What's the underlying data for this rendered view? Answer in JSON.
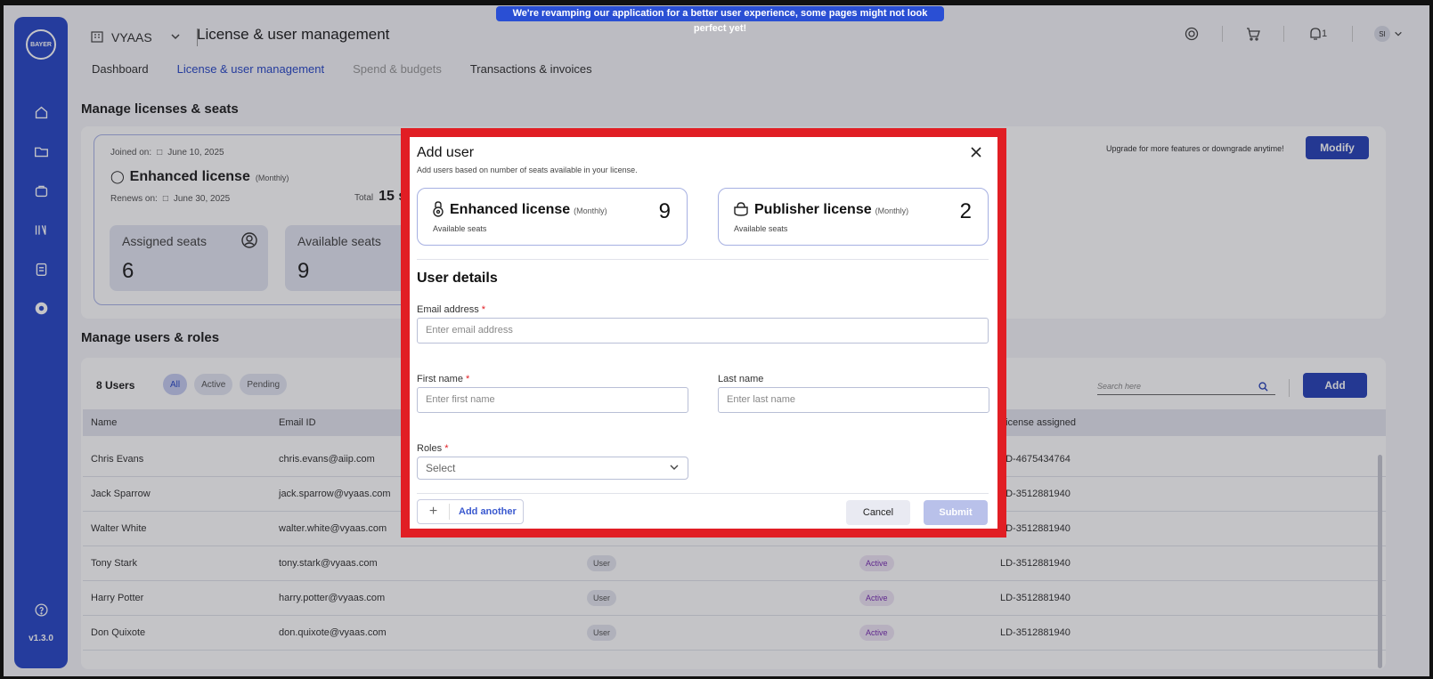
{
  "banner": "We're revamping our application for a better user experience, some pages might not look perfect yet!",
  "sidebar": {
    "logo": "BAYER",
    "icons": [
      "home-icon",
      "folder-icon",
      "bag-icon",
      "library-icon",
      "clipboard-icon",
      "settings-icon",
      "help-icon"
    ],
    "version": "v1.3.0"
  },
  "header": {
    "org": "VYAAS",
    "title": "License & user management",
    "notifications_count": "1",
    "avatar": "SI"
  },
  "tabs": [
    {
      "label": "Dashboard"
    },
    {
      "label": "License & user management"
    },
    {
      "label": "Spend & budgets"
    },
    {
      "label": "Transactions & invoices"
    }
  ],
  "licenses_section": {
    "title": "Manage licenses & seats",
    "joined_label": "Joined on:",
    "joined_date": "June 10, 2025",
    "license_name": "Enhanced license",
    "license_period": "(Monthly)",
    "renews_label": "Renews on:",
    "renews_date": "June 30, 2025",
    "total_label": "Total",
    "total_value": "15 s",
    "assigned_label": "Assigned seats",
    "assigned_value": "6",
    "available_label": "Available seats",
    "available_value": "9",
    "upgrade_text": "Upgrade for more features or downgrade anytime!",
    "modify_label": "Modify"
  },
  "users_section": {
    "title": "Manage users & roles",
    "count": "8 Users",
    "filters": [
      "All",
      "Active",
      "Pending"
    ],
    "search_placeholder": "Search here",
    "add_label": "Add",
    "columns": [
      "Name",
      "Email ID",
      "License assigned"
    ],
    "rows": [
      {
        "name": "Chris Evans",
        "email": "chris.evans@aiip.com",
        "role": "",
        "status": "",
        "license": "LD-4675434764"
      },
      {
        "name": "Jack Sparrow",
        "email": "jack.sparrow@vyaas.com",
        "role": "",
        "status": "",
        "license": "LD-3512881940"
      },
      {
        "name": "Walter White",
        "email": "walter.white@vyaas.com",
        "role": "",
        "status": "",
        "license": "LD-3512881940"
      },
      {
        "name": "Tony Stark",
        "email": "tony.stark@vyaas.com",
        "role": "User",
        "status": "Active",
        "license": "LD-3512881940"
      },
      {
        "name": "Harry Potter",
        "email": "harry.potter@vyaas.com",
        "role": "User",
        "status": "Active",
        "license": "LD-3512881940"
      },
      {
        "name": "Don Quixote",
        "email": "don.quixote@vyaas.com",
        "role": "User",
        "status": "Active",
        "license": "LD-3512881940"
      }
    ]
  },
  "modal": {
    "title": "Add user",
    "subtitle": "Add users based on number of seats available in your license.",
    "licenses": [
      {
        "name": "Enhanced license",
        "period": "(Monthly)",
        "seats_label": "Available seats",
        "seats": "9"
      },
      {
        "name": "Publisher license",
        "period": "(Monthly)",
        "seats_label": "Available seats",
        "seats": "2"
      }
    ],
    "details_title": "User details",
    "email_label": "Email address",
    "email_placeholder": "Enter email address",
    "first_name_label": "First name",
    "first_name_placeholder": "Enter first name",
    "last_name_label": "Last name",
    "last_name_placeholder": "Enter last name",
    "roles_label": "Roles",
    "roles_value": "Select",
    "required_mark": "*",
    "add_another_label": "Add another",
    "cancel_label": "Cancel",
    "submit_label": "Submit"
  },
  "colors": {
    "primary": "#2a44b8",
    "sidebar": "#2b4ac7",
    "highlight": "#e11e24"
  }
}
